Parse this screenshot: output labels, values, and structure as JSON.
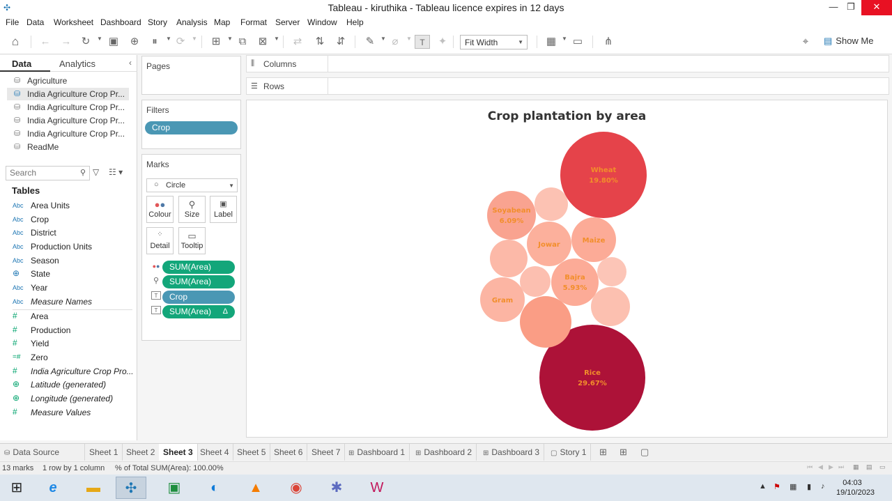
{
  "window": {
    "title": "Tableau - kiruthika - Tableau licence expires in 12 days",
    "minimize": "—",
    "restore": "❐",
    "close": "✕"
  },
  "menu": [
    "File",
    "Data",
    "Worksheet",
    "Dashboard",
    "Story",
    "Analysis",
    "Map",
    "Format",
    "Server",
    "Window",
    "Help"
  ],
  "toolbar": {
    "fit_width": "Fit Width",
    "show_me": "Show Me"
  },
  "data_pane": {
    "tab_data": "Data",
    "tab_analytics": "Analytics",
    "data_sources": [
      "Agriculture",
      "India Agriculture Crop Pr...",
      "India Agriculture Crop Pr...",
      "India Agriculture Crop Pr...",
      "India Agriculture Crop Pr...",
      "ReadMe"
    ],
    "search_placeholder": "Search",
    "tables_heading": "Tables",
    "dimensions": [
      {
        "type": "Abc",
        "name": "Area Units"
      },
      {
        "type": "Abc",
        "name": "Crop"
      },
      {
        "type": "Abc",
        "name": "District"
      },
      {
        "type": "Abc",
        "name": "Production Units"
      },
      {
        "type": "Abc",
        "name": "Season"
      },
      {
        "type": "globe",
        "name": "State"
      },
      {
        "type": "Abc",
        "name": "Year"
      },
      {
        "type": "Abc",
        "name": "Measure Names"
      }
    ],
    "measures": [
      {
        "type": "#",
        "name": "Area"
      },
      {
        "type": "#",
        "name": "Production"
      },
      {
        "type": "#",
        "name": "Yield"
      },
      {
        "type": "=#",
        "name": "Zero"
      },
      {
        "type": "#",
        "name": "India Agriculture Crop Pro..."
      },
      {
        "type": "globe",
        "name": "Latitude (generated)"
      },
      {
        "type": "globe",
        "name": "Longitude (generated)"
      },
      {
        "type": "#",
        "name": "Measure Values"
      }
    ]
  },
  "shelves": {
    "pages": "Pages",
    "filters": "Filters",
    "filter_pill": "Crop",
    "marks": "Marks",
    "mark_type": "Circle",
    "mark_buttons": [
      "Colour",
      "Size",
      "Label",
      "Detail",
      "Tooltip"
    ],
    "encodings": [
      {
        "label": "SUM(Area)",
        "color": "green"
      },
      {
        "label": "SUM(Area)",
        "color": "green"
      },
      {
        "label": "Crop",
        "color": "blue"
      },
      {
        "label": "SUM(Area)",
        "color": "green",
        "flag": "Δ"
      }
    ],
    "columns": "Columns",
    "rows": "Rows"
  },
  "chart_data": {
    "type": "packed-bubble",
    "title": "Crop plantation by area",
    "size_measure": "SUM(Area)",
    "color_measure": "SUM(Area)",
    "color_scale": [
      "#fcbba1",
      "#e8434a",
      "#a50f3a"
    ],
    "bubbles": [
      {
        "crop": "Rice",
        "share_pct": 29.67,
        "label_pct": "29.67%"
      },
      {
        "crop": "Wheat",
        "share_pct": 19.8,
        "label_pct": "19.80%"
      },
      {
        "crop": "Soyabean",
        "share_pct": 6.09,
        "label_pct": "6.09%"
      },
      {
        "crop": "Bajra",
        "share_pct": 5.93,
        "label_pct": "5.93%"
      },
      {
        "crop": "Maize",
        "share_pct": null,
        "label_pct": ""
      },
      {
        "crop": "Jowar",
        "share_pct": null,
        "label_pct": ""
      },
      {
        "crop": "Gram",
        "share_pct": null,
        "label_pct": ""
      },
      {
        "crop": "",
        "share_pct": null,
        "label_pct": ""
      },
      {
        "crop": "",
        "share_pct": null,
        "label_pct": ""
      },
      {
        "crop": "",
        "share_pct": null,
        "label_pct": ""
      },
      {
        "crop": "",
        "share_pct": null,
        "label_pct": ""
      },
      {
        "crop": "",
        "share_pct": null,
        "label_pct": ""
      },
      {
        "crop": "",
        "share_pct": null,
        "label_pct": ""
      }
    ],
    "label_color": "#f28e2b"
  },
  "sheet_tabs": [
    {
      "label": "Data Source",
      "icon": "datasource-icon",
      "active": false
    },
    {
      "label": "Sheet 1",
      "active": false
    },
    {
      "label": "Sheet 2",
      "active": false
    },
    {
      "label": "Sheet 3",
      "active": true
    },
    {
      "label": "Sheet 4",
      "active": false
    },
    {
      "label": "Sheet 5",
      "active": false
    },
    {
      "label": "Sheet 6",
      "active": false
    },
    {
      "label": "Sheet 7",
      "active": false
    },
    {
      "label": "Dashboard 1",
      "icon": "dashboard-icon",
      "active": false
    },
    {
      "label": "Dashboard 2",
      "icon": "dashboard-icon",
      "active": false
    },
    {
      "label": "Dashboard 3",
      "icon": "dashboard-icon",
      "active": false
    },
    {
      "label": "Story 1",
      "icon": "story-icon",
      "active": false
    }
  ],
  "status": {
    "marks": "13 marks",
    "rows_cols": "1 row by 1 column",
    "total": "% of Total SUM(Area): 100.00%"
  },
  "taskbar": {
    "time": "04:03",
    "date": "19/10/2023"
  }
}
